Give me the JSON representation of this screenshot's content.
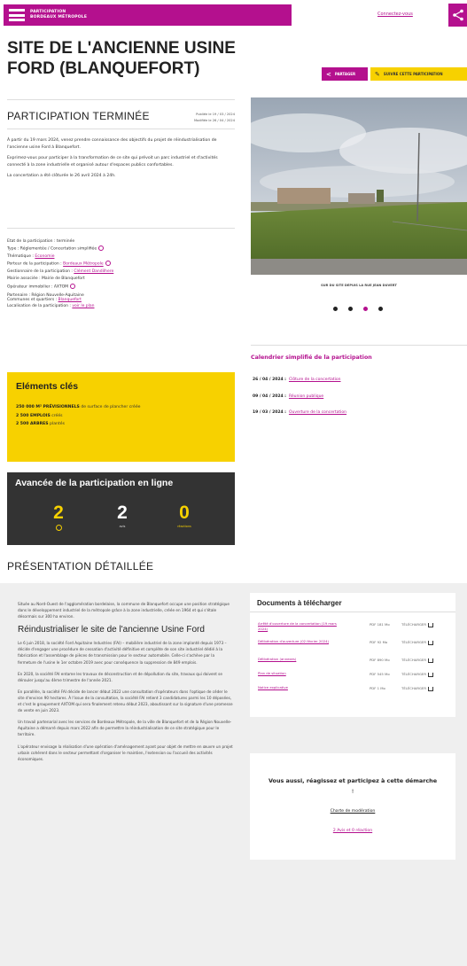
{
  "header": {
    "brand_line1": "PARTICIPATION",
    "brand_line2": "BORDEAUX MÉTROPOLE",
    "login_link": "Connectez-vous"
  },
  "page": {
    "title": "SITE DE L'ANCIENNE USINE FORD (BLANQUEFORT)",
    "share_button": "PARTAGER",
    "follow_button": "SUIVRE CETTE PARTICIPATION"
  },
  "status": {
    "title": "PARTICIPATION TERMINÉE",
    "published": "Publiée le 19 / 03 / 2024",
    "modified": "Modifiée le 26 / 04 / 2024"
  },
  "intro": {
    "p1": "À partir du 19 mars 2024, venez prendre connaissance des objectifs du projet de réindustrialisation de l'ancienne usine Ford à Blanquefort.",
    "p2": "Exprimez-vous pour participer à la transformation de ce site qui prévoit un parc industriel et d'activités connecté à la zone industrielle et organisé autour d'espaces publics confortables.",
    "p3": "La concertation a été clôturée le 26 avril 2024 à 24h."
  },
  "details": {
    "state": "Etat de la participation : terminée",
    "type": "Type : Réglementée / Concertation simplifiée",
    "theme_label": "Thématique : ",
    "theme_value": "Economie",
    "pilot_label": "Porteur de la participation : ",
    "pilot_value": "Bordeaux Métropole",
    "manager_label": "Gestionnaire de la participation : ",
    "manager_value": "Clément Dandilhere",
    "associated": "Mairie associée : Mairie de Blanquefort",
    "operator": "Opérateur immobilier : AXTOM",
    "partner": "Partenaire : Région Nouvelle-Aquitaine",
    "communes_label": "Communes et quartiers : ",
    "communes_value": "Blanquefort",
    "location_label": "Localisation de la participation : ",
    "location_value": "voir le plan"
  },
  "photo": {
    "caption": "SUR DU SITE DEPUIS LA RUE JEAN DUVERT"
  },
  "calendar": {
    "title": "Calendrier simplifié de la participation",
    "items": [
      {
        "date": "26 / 04 / 2024 :",
        "label": "Clôture de la concertation"
      },
      {
        "date": "09 / 04 / 2024 :",
        "label": "Réunion publique"
      },
      {
        "date": "19 / 03 / 2024 :",
        "label": "Ouverture de la concertation"
      }
    ]
  },
  "key": {
    "title": "Eléments clés",
    "item1_bold": "250 000 M² PRÉVISIONNELS",
    "item1_rest": " de surface de plancher créée",
    "item2_bold": "2 500 EMPLOIS",
    "item2_rest": " créés",
    "item3_bold": "2 500 ARBRES",
    "item3_rest": " plantés"
  },
  "progress": {
    "title": "Avancée de la participation en ligne",
    "metric1_value": "2",
    "metric2_value": "2",
    "metric2_label": "avis",
    "metric3_value": "0",
    "metric3_label": "réactions"
  },
  "presentation": {
    "title": "PRÉSENTATION DÉTAILLÉE",
    "p1": "Située au Nord-Ouest de l'agglomération bordelaise, la commune de Blanquefort occupe une position stratégique dans le développement industriel de la métropole grâce à la zone industrielle, créée en 1964 et qui s'étale désormais sur 300 ha environ.",
    "heading": "Réindustrialiser le site de l'ancienne Usine Ford",
    "p2": "Le 6 juin 2018, la société Ford Aquitaine Industries (FAI) – mobilière industriel de la zone implanté depuis 1973 – décide d'engager une procédure de cessation d'activité définitive et complète de son site industriel dédié à la fabrication et l'assemblage de pièces de transmission pour le secteur automobile. Celle-ci s'achève par la fermeture de l'usine le 1er octobre 2019 avec pour conséquence la suppression de 849 emplois.",
    "p3": "En 2020, la société FAI entame les travaux de déconstruction et de dépollution du site, travaux qui doivent se dérouler jusqu'au 4ème trimestre de l'année 2021.",
    "p4": "En parallèle, la société FAI décide de lancer début 2022 une consultation d'opérateurs dans l'optique de céder le site d'environ 90 hectares. À l'issue de la consultation, la société FAI retient 3 candidatures parmi les 10 déposées, et c'est le groupement AXTOM qui sera finalement retenu début 2023, aboutissant sur la signature d'une promesse de vente en juin 2023.",
    "p5": "Un travail partenarial avec les services de Bordeaux Métropole, de la ville de Blanquefort et de la Région Nouvelle-Aquitaine a démarré depuis mars 2022 afin de permettre la réindustrialisation de ce site stratégique pour le territoire.",
    "p6": "L'opérateur envisage la réalisation d'une opération d'aménagement ayant pour objet de mettre en œuvre un projet urbain cohérent dans le secteur permettant d'organiser le maintien, l'extension ou l'accueil des activités économiques."
  },
  "documents": {
    "title": "Documents à télécharger",
    "items": [
      {
        "name": "Arrêté d'ouverture de la concertation (19 mars 2024)",
        "size": "PDF 181 Mo",
        "dl": "TÉLÉCHARGER"
      },
      {
        "name": "Délibération d'ouverture (02 février 2024)",
        "size": "PDF 92 Mo",
        "dl": "TÉLÉCHARGER"
      },
      {
        "name": "Délibération (annexes)",
        "size": "PDF 890 Mo",
        "dl": "TÉLÉCHARGER"
      },
      {
        "name": "Plan de situation",
        "size": "PDF 545 Mo",
        "dl": "TÉLÉCHARGER"
      },
      {
        "name": "Notice explicative",
        "size": "PDF 1 Mo",
        "dl": "TÉLÉCHARGER"
      }
    ]
  },
  "react": {
    "text_bold": "Vous aussi, réagissez et participez à cette démarche",
    "text_rest": " !",
    "charter": "Charte de modération",
    "avis": "2 Avis et 0 réaction"
  },
  "colors": {
    "brand": "#b4108e",
    "accent": "#f7d100",
    "dark_panel": "#333333"
  }
}
